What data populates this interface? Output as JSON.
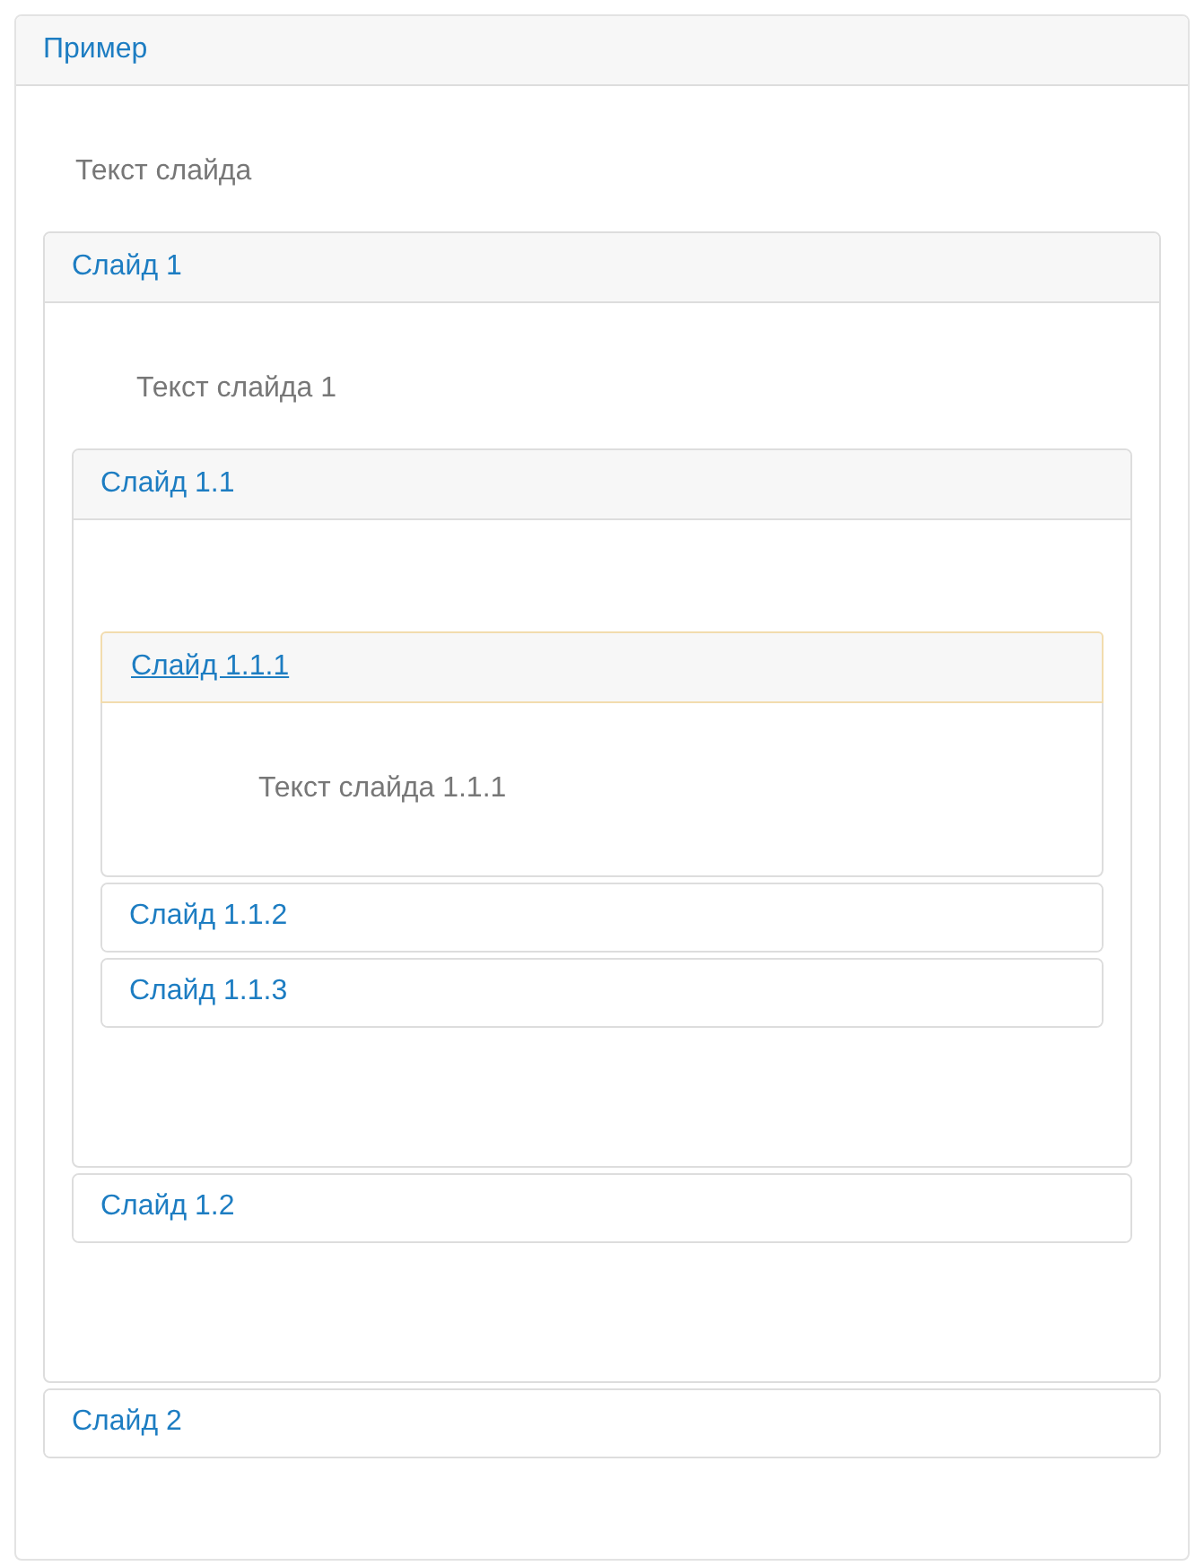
{
  "accordion": {
    "title": "Пример",
    "expanded": true,
    "focused": false,
    "text": "Текст слайда",
    "children": [
      {
        "title": "Слайд 1",
        "expanded": true,
        "focused": false,
        "text": "Текст слайда 1",
        "children": [
          {
            "title": "Слайд 1.1",
            "expanded": true,
            "focused": false,
            "children": [
              {
                "title": "Слайд 1.1.1",
                "expanded": true,
                "focused": true,
                "text": "Текст слайда 1.1.1"
              },
              {
                "title": "Слайд 1.1.2",
                "expanded": false,
                "focused": false
              },
              {
                "title": "Слайд 1.1.3",
                "expanded": false,
                "focused": false
              }
            ]
          },
          {
            "title": "Слайд 1.2",
            "expanded": false,
            "focused": false
          }
        ]
      },
      {
        "title": "Слайд 2",
        "expanded": false,
        "focused": false
      }
    ]
  }
}
